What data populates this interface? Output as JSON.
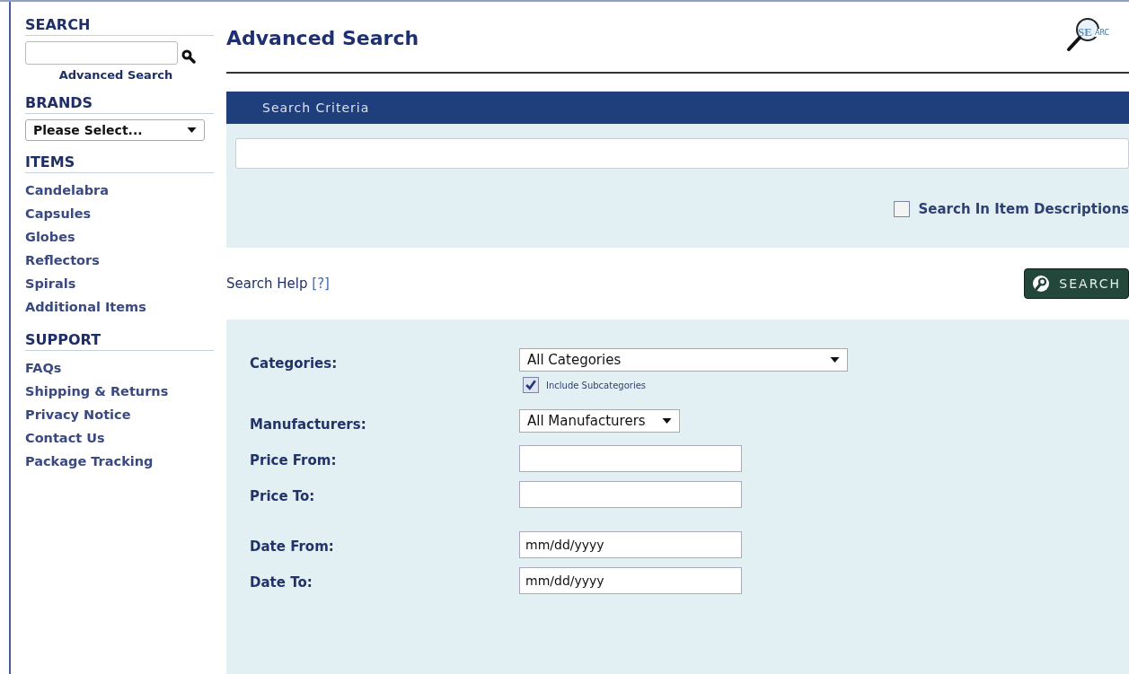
{
  "sidebar": {
    "search": {
      "heading": "SEARCH",
      "advanced_link": "Advanced Search"
    },
    "brands": {
      "heading": "BRANDS",
      "select": "Please Select..."
    },
    "items": {
      "heading": "ITEMS",
      "links": [
        "Candelabra",
        "Capsules",
        "Globes",
        "Reflectors",
        "Spirals",
        "Additional Items"
      ]
    },
    "support": {
      "heading": "SUPPORT",
      "links": [
        "FAQs",
        "Shipping & Returns",
        "Privacy Notice",
        "Contact Us",
        "Package Tracking"
      ]
    }
  },
  "main": {
    "title": "Advanced Search",
    "logo": {
      "circle_text": "SE",
      "tail_text": "ARC"
    },
    "criteria_bar": "Search Criteria",
    "item_descriptions": {
      "label": "Search In Item Descriptions",
      "checked": false
    },
    "help": {
      "text": "Search Help",
      "link": "[?]"
    },
    "search_button": "SEARCH",
    "form": [
      {
        "kind": "select",
        "label": "Categories:",
        "value": "All Categories",
        "sub": {
          "label": "Include Subcategories",
          "checked": true
        }
      },
      {
        "kind": "select",
        "label": "Manufacturers:",
        "value": "All Manufacturers"
      },
      {
        "kind": "input",
        "label": "Price From:"
      },
      {
        "kind": "input",
        "label": "Price To:"
      },
      {
        "kind": "input",
        "label": "Date From:",
        "value": "mm/dd/yyyy"
      },
      {
        "kind": "input",
        "label": "Date To:",
        "value": "mm/dd/yyyy"
      }
    ]
  }
}
